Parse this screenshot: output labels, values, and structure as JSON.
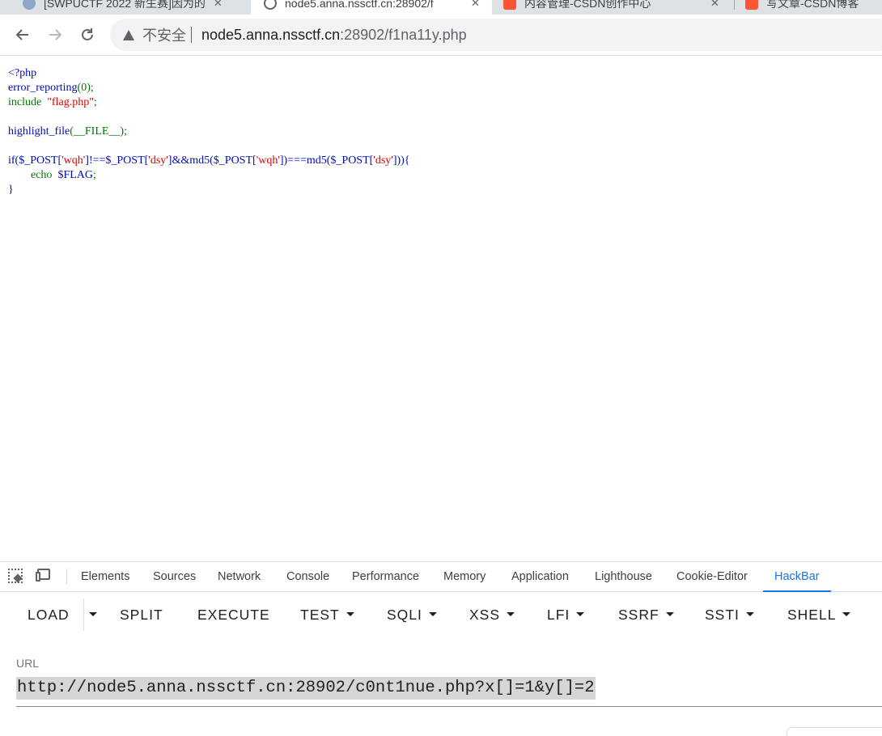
{
  "browser": {
    "tabs": [
      {
        "title": "[SWPUCTF 2022 新生赛]因为的",
        "active": false
      },
      {
        "title": "node5.anna.nssctf.cn:28902/f",
        "active": true
      },
      {
        "title": "内容管理-CSDN创作中心",
        "active": false
      },
      {
        "title": "写文章-CSDN博客",
        "active": false
      }
    ],
    "nav_icons": [
      "back-arrow-icon",
      "forward-arrow-icon",
      "reload-icon"
    ],
    "security_label": "不安全",
    "url_host": "node5.anna.nssctf.cn",
    "url_path": ":28902/f1na11y.php"
  },
  "source": {
    "lines": {
      "l1": "<?php",
      "l2_fn": "error_reporting",
      "l2_rest": "(0);",
      "l3_kw": "include",
      "l3_str": "\"flag.php\"",
      "l3_end": ";",
      "l5_fn": "highlight_file",
      "l5_rest": "(__FILE__);",
      "l7_a": "if($_POST[",
      "l7_s1": "'wqh'",
      "l7_b": "]!==$_POST[",
      "l7_s2": "'dsy'",
      "l7_c": "]&&md5($_POST[",
      "l7_s3": "'wqh'",
      "l7_d": "])===md5($_POST[",
      "l7_s4": "'dsy'",
      "l7_e": "])){",
      "l8_kw": "echo",
      "l8_var": "$FLAG",
      "l8_end": ";",
      "l9": "}"
    },
    "colors": {
      "keyword": "#007700",
      "default": "#000bb0",
      "string": "#dd0000"
    }
  },
  "devtools": {
    "tabs": [
      "Elements",
      "Sources",
      "Network",
      "Console",
      "Performance",
      "Memory",
      "Application",
      "Lighthouse",
      "Cookie-Editor",
      "HackBar"
    ],
    "active_tab": "HackBar",
    "accent": "#1a73e8"
  },
  "hackbar": {
    "buttons": [
      "LOAD",
      "SPLIT",
      "EXECUTE",
      "TEST",
      "SQLI",
      "XSS",
      "LFI",
      "SSRF",
      "SSTI",
      "SHELL"
    ],
    "url_label": "URL",
    "url_value": "http://node5.anna.nssctf.cn:28902/c0nt1nue.php?x[]=1&y[]=2"
  }
}
